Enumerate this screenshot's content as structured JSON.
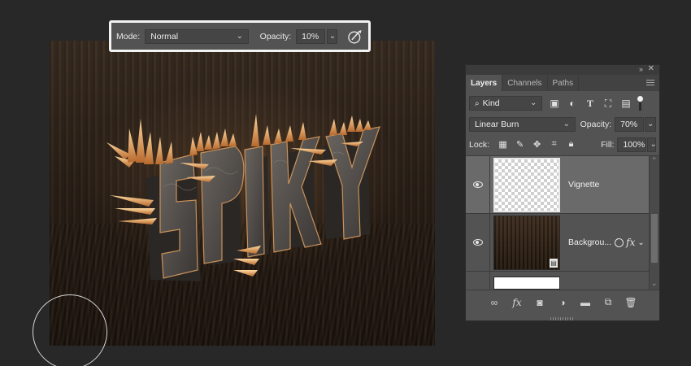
{
  "options_bar": {
    "mode_label": "Mode:",
    "mode_value": "Normal",
    "opacity_label": "Opacity:",
    "opacity_value": "10%"
  },
  "canvas": {
    "artwork_text": "SPIKY",
    "colors": {
      "letter": "#4a4644",
      "spike": "#e6a35a",
      "background": "#2c2118"
    }
  },
  "layers_panel": {
    "tabs": [
      "Layers",
      "Channels",
      "Paths"
    ],
    "active_tab": "Layers",
    "filter_kind": "Kind",
    "blend_mode": "Linear Burn",
    "opacity_label": "Opacity:",
    "opacity_value": "70%",
    "lock_label": "Lock:",
    "fill_label": "Fill:",
    "fill_value": "100%",
    "layers": [
      {
        "name": "Vignette",
        "selected": true,
        "visible": true
      },
      {
        "name": "Backgrou...",
        "selected": false,
        "visible": true,
        "has_fx": true
      }
    ]
  },
  "icons": {
    "filter": [
      "image-filter-icon",
      "adjustment-filter-icon",
      "type-filter-icon",
      "shape-filter-icon",
      "smart-object-filter-icon"
    ],
    "lock": [
      "lock-transparent-icon",
      "lock-pixels-icon",
      "lock-position-icon",
      "lock-artboard-icon",
      "lock-all-icon"
    ],
    "bottom": [
      "link-layers-icon",
      "fx-icon",
      "add-mask-icon",
      "adjustment-layer-icon",
      "new-group-icon",
      "new-layer-icon",
      "delete-layer-icon"
    ]
  }
}
